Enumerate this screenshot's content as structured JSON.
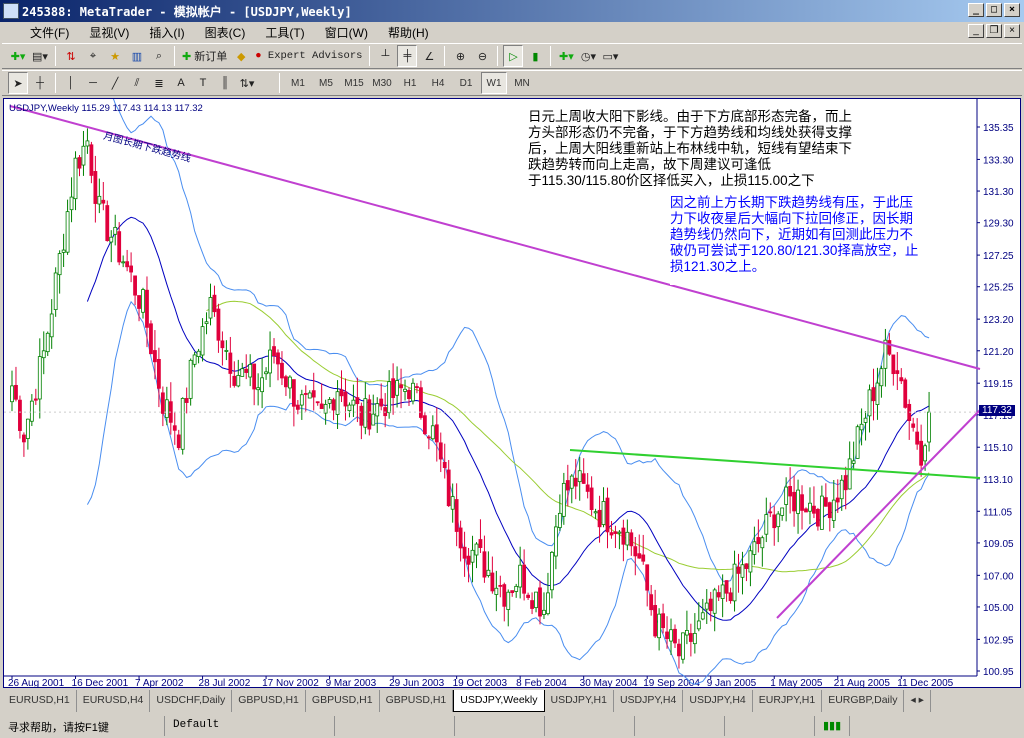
{
  "window": {
    "title": "245388: MetaTrader - 模拟帐户 - [USDJPY,Weekly]"
  },
  "menu": [
    "文件(F)",
    "显视(V)",
    "插入(I)",
    "图表(C)",
    "工具(T)",
    "窗口(W)",
    "帮助(H)"
  ],
  "toolbar": {
    "new_order": "新订单",
    "expert_advisors": "Expert Advisors"
  },
  "timeframes": [
    "M1",
    "M5",
    "M15",
    "M30",
    "H1",
    "H4",
    "D1",
    "W1",
    "MN"
  ],
  "active_timeframe": "W1",
  "chart": {
    "header": "USDJPY,Weekly  115.29 117.43 114.13 117.32",
    "trendline_label": "月图长期下跌趋势线",
    "note_black": "日元上周收大阳下影线。由于下方底部形态完备，而上\n方头部形态仍不完备，于下方趋势线和均线处获得支撑\n后，上周大阳线重新站上布林线中轨，短线有望结束下\n跌趋势转而向上走高，故下周建议可逢低\n于115.30/115.80价区择低买入，止损115.00之下",
    "note_blue": "因之前上方长期下跌趋势线有压，于此压\n力下收夜星后大幅向下拉回修正，因长期\n趋势线仍然向下，近期如有回测此压力不\n破仍可尝试于120.80/121.30择高放空，止\n损121.30之上。",
    "current_price": "117.32"
  },
  "chart_data": {
    "type": "candlestick",
    "symbol": "USDJPY",
    "period": "Weekly",
    "price_ticks": [
      "135.35",
      "133.30",
      "131.30",
      "129.30",
      "127.25",
      "125.25",
      "123.20",
      "121.20",
      "119.15",
      "117.15",
      "115.10",
      "113.10",
      "111.05",
      "109.05",
      "107.00",
      "105.00",
      "102.95",
      "100.95"
    ],
    "ylim": [
      100.95,
      135.35
    ],
    "date_ticks": [
      "26 Aug 2001",
      "16 Dec 2001",
      "7 Apr 2002",
      "28 Jul 2002",
      "17 Nov 2002",
      "9 Mar 2003",
      "29 Jun 2003",
      "19 Oct 2003",
      "8 Feb 2004",
      "30 May 2004",
      "19 Sep 2004",
      "9 Jan 2005",
      "1 May 2005",
      "21 Aug 2005",
      "11 Dec 2005"
    ],
    "close_anchors_week_price": [
      [
        0,
        119
      ],
      [
        3,
        116
      ],
      [
        8,
        121
      ],
      [
        12,
        127
      ],
      [
        16,
        133
      ],
      [
        19,
        134.5
      ],
      [
        22,
        130
      ],
      [
        28,
        127
      ],
      [
        33,
        124
      ],
      [
        38,
        118
      ],
      [
        42,
        116
      ],
      [
        46,
        121
      ],
      [
        50,
        124
      ],
      [
        56,
        120
      ],
      [
        62,
        119
      ],
      [
        66,
        121
      ],
      [
        72,
        118
      ],
      [
        78,
        117
      ],
      [
        82,
        119
      ],
      [
        88,
        117
      ],
      [
        94,
        118
      ],
      [
        100,
        119
      ],
      [
        106,
        116
      ],
      [
        110,
        112
      ],
      [
        114,
        109
      ],
      [
        118,
        108
      ],
      [
        124,
        106
      ],
      [
        128,
        107
      ],
      [
        134,
        105
      ],
      [
        138,
        112
      ],
      [
        142,
        113
      ],
      [
        148,
        111
      ],
      [
        154,
        110
      ],
      [
        158,
        108
      ],
      [
        162,
        104
      ],
      [
        168,
        102
      ],
      [
        174,
        104
      ],
      [
        180,
        106
      ],
      [
        186,
        108
      ],
      [
        192,
        111
      ],
      [
        198,
        112
      ],
      [
        204,
        111
      ],
      [
        210,
        113
      ],
      [
        216,
        118
      ],
      [
        220,
        121
      ],
      [
        223,
        120.5
      ],
      [
        226,
        117
      ],
      [
        229,
        115
      ],
      [
        231,
        117.32
      ]
    ],
    "colors": {
      "bull": "#008000",
      "bear": "#e0003c",
      "ma_fast": "#0000c0",
      "ma_slow": "#9acd32",
      "bands": "#4a8ef0",
      "trend_down": "#c040d0",
      "trend_up": "#c040d0",
      "neckline": "#30d030"
    }
  },
  "tabs": [
    "EURUSD,H1",
    "EURUSD,H4",
    "USDCHF,Daily",
    "GBPUSD,H1",
    "GBPUSD,H1",
    "GBPUSD,H1",
    "USDJPY,Weekly",
    "USDJPY,H1",
    "USDJPY,H4",
    "USDJPY,H4",
    "EURJPY,H1",
    "EURGBP,Daily"
  ],
  "active_tab": "USDJPY,Weekly",
  "status": {
    "help": "寻求帮助，请按F1键",
    "profile": "Default"
  }
}
